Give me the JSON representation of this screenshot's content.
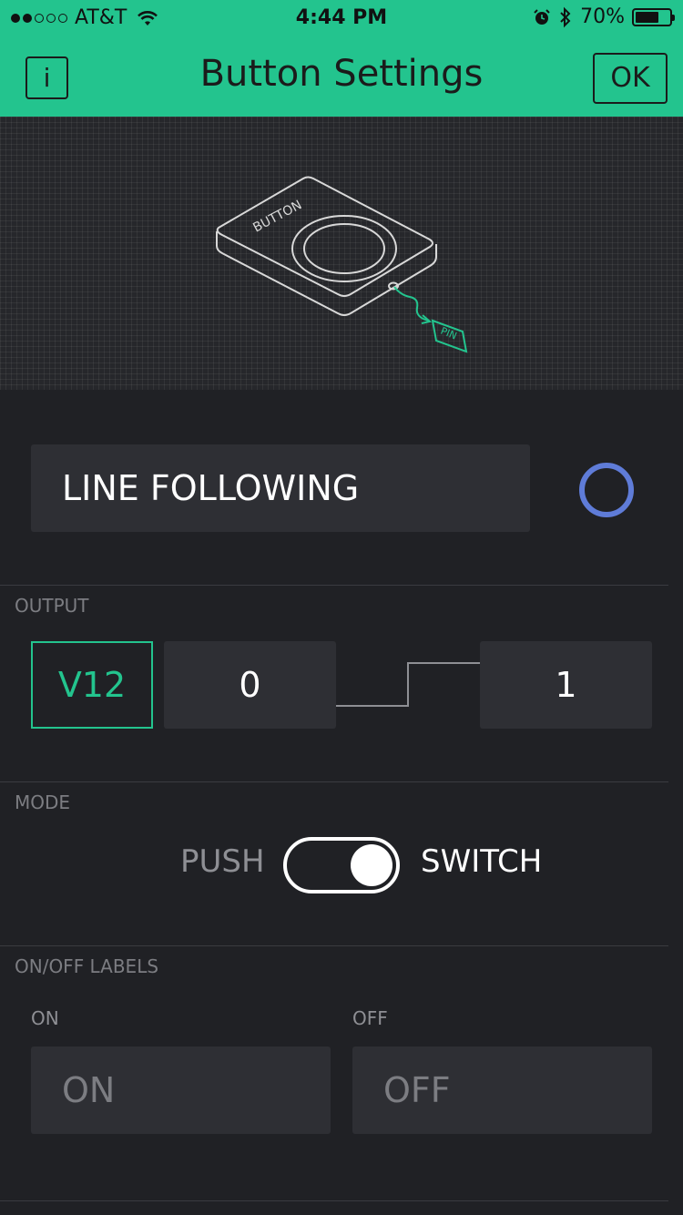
{
  "status_bar": {
    "carrier": "AT&T",
    "signal_dots_filled": 2,
    "signal_dots_total": 5,
    "time": "4:44 PM",
    "battery_percent": "70%",
    "battery_level": 0.7,
    "icons": [
      "wifi-icon",
      "alarm-icon",
      "bluetooth-icon",
      "battery-icon"
    ]
  },
  "nav": {
    "info_label": "i",
    "title": "Button Settings",
    "ok_label": "OK"
  },
  "illustration": {
    "device_label": "BUTTON",
    "pin_label": "PIN"
  },
  "widget_name": {
    "value": "LINE FOLLOWING",
    "color": "#5f7cd8"
  },
  "output": {
    "section_label": "OUTPUT",
    "pin": "V12",
    "low_value": "0",
    "high_value": "1"
  },
  "mode": {
    "section_label": "MODE",
    "push_label": "PUSH",
    "switch_label": "SWITCH",
    "selected": "SWITCH"
  },
  "labels": {
    "section_label": "ON/OFF LABELS",
    "on_caption": "ON",
    "off_caption": "OFF",
    "on_placeholder": "ON",
    "off_placeholder": "OFF"
  },
  "colors": {
    "accent": "#23c48e",
    "background": "#202125",
    "field": "#2e2f34"
  }
}
